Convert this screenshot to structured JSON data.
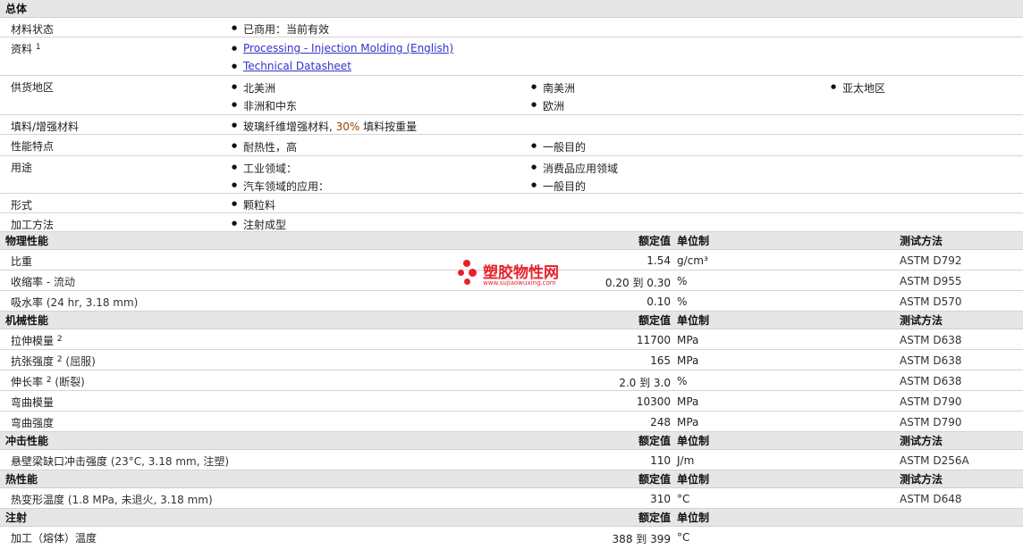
{
  "general": {
    "title": "总体",
    "status": {
      "label": "材料状态",
      "value": "已商用：当前有效"
    },
    "info": {
      "label": "资料",
      "sup": "1",
      "links": [
        "Processing - Injection Molding (English)",
        "Technical Datasheet"
      ]
    },
    "supply": {
      "label": "供货地区",
      "items": [
        "北美洲",
        "南美洲",
        "亚太地区",
        "非洲和中东",
        "欧洲"
      ]
    },
    "filler": {
      "label": "填料/增强材料",
      "pre": "玻璃纤维增强材料, ",
      "hl": "30%",
      "post": " 填料按重量"
    },
    "features": {
      "label": "性能特点",
      "items": [
        "耐热性，高",
        "一般目的"
      ]
    },
    "uses": {
      "label": "用途",
      "items": [
        "工业领域：",
        "消费品应用领域",
        "汽车领域的应用：",
        "一般目的"
      ]
    },
    "form": {
      "label": "形式",
      "items": [
        "颗粒料"
      ]
    },
    "method": {
      "label": "加工方法",
      "items": [
        "注射成型"
      ]
    }
  },
  "headers": {
    "value": "额定值",
    "unit": "单位制",
    "test": "测试方法"
  },
  "physical": {
    "title": "物理性能",
    "rows": [
      {
        "label": "比重",
        "sup": "",
        "cond": "",
        "value": "1.54",
        "unit": "g/cm³",
        "test": "ASTM D792"
      },
      {
        "label": "收缩率",
        "sup": "",
        "cond": " - 流动",
        "value": "0.20 到  0.30",
        "unit": "%",
        "test": "ASTM D955"
      },
      {
        "label": "吸水率",
        "sup": "",
        "cond": " (24 hr, 3.18 mm)",
        "value": "0.10",
        "unit": "%",
        "test": "ASTM D570"
      }
    ]
  },
  "mechanical": {
    "title": "机械性能",
    "rows": [
      {
        "label": "拉伸模量",
        "sup": "2",
        "cond": "",
        "value": "11700",
        "unit": "MPa",
        "test": "ASTM D638"
      },
      {
        "label": "抗张强度",
        "sup": "2",
        "cond": " (屈服)",
        "value": "165",
        "unit": "MPa",
        "test": "ASTM D638"
      },
      {
        "label": "伸长率",
        "sup": "2",
        "cond": " (断裂)",
        "value": "2.0 到  3.0",
        "unit": "%",
        "test": "ASTM D638"
      },
      {
        "label": "弯曲模量",
        "sup": "",
        "cond": "",
        "value": "10300",
        "unit": "MPa",
        "test": "ASTM D790"
      },
      {
        "label": "弯曲强度",
        "sup": "",
        "cond": "",
        "value": "248",
        "unit": "MPa",
        "test": "ASTM D790"
      }
    ]
  },
  "impact": {
    "title": "冲击性能",
    "rows": [
      {
        "label": "悬壁梁缺口冲击强度",
        "sup": "",
        "cond": " (23°C, 3.18 mm, 注塑)",
        "value": "110",
        "unit": "J/m",
        "test": "ASTM D256A"
      }
    ]
  },
  "thermal": {
    "title": "热性能",
    "rows": [
      {
        "label": "热变形温度",
        "sup": "",
        "cond": " (1.8 MPa, 未退火, 3.18 mm)",
        "value": "310",
        "unit": "°C",
        "test": "ASTM D648"
      }
    ]
  },
  "injection": {
    "title": "注射",
    "rows": [
      {
        "label": "加工（熔体）温度",
        "sup": "",
        "cond": "",
        "value": "388 到  399",
        "unit": "°C",
        "test": ""
      }
    ]
  },
  "watermark": {
    "cn": "塑胶物性网",
    "en": "www.sujiaowuxing.com"
  }
}
